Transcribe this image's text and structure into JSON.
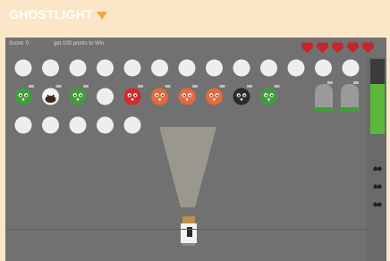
{
  "banner": {
    "title": "GHOSTLIGHT",
    "arrow_color": "#f0a93a"
  },
  "hud": {
    "score": "Score: 0",
    "goal": "get 100 points to Win"
  },
  "lives": {
    "count": 5,
    "icon": "heart-icon",
    "color": "#c8242b"
  },
  "rows": [
    [
      "white",
      "white",
      "white",
      "white",
      "white",
      "white",
      "white",
      "white",
      "white",
      "white",
      "white",
      "white",
      "white"
    ],
    [
      "green",
      "pig",
      "green",
      "white",
      "red",
      "orange",
      "orange",
      "orange",
      "black",
      "green"
    ],
    [
      "white",
      "white",
      "white",
      "white",
      "white"
    ]
  ],
  "tombstones": {
    "count": 2,
    "icon": "tombstone-icon"
  },
  "player": {
    "icon": "lantern-icon"
  },
  "side_panel": {
    "meter_level": 0.95,
    "meter_color": "#5ab83b",
    "icons": [
      "bird-icon",
      "bird-icon",
      "bird-icon"
    ]
  },
  "colors": {
    "white": "#eeeeee",
    "green": "#3f9e3a",
    "red": "#d6282c",
    "orange": "#e4693b",
    "black": "#2a2a2a",
    "background": "#717171"
  }
}
